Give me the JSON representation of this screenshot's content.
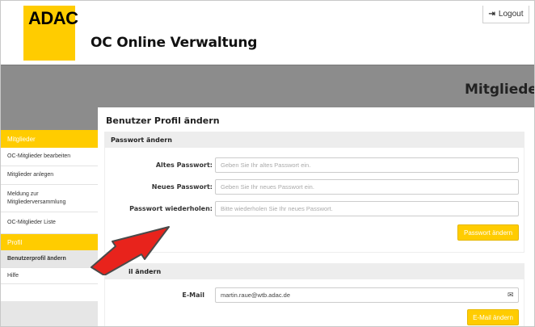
{
  "header": {
    "logo_text": "ADAC",
    "app_title": "OC Online Verwaltung",
    "logout_label": "Logout"
  },
  "banner": {
    "section_title": "Mitglieder"
  },
  "sidebar": {
    "groups": [
      {
        "heading": "Mitglieder",
        "items": [
          {
            "label": "OC-Mitglieder bearbeiten"
          },
          {
            "label": "Mitglieder anlegen"
          },
          {
            "label": "Meldung zur Mitgliederversammlung"
          },
          {
            "label": "OC-Mitglieder Liste"
          }
        ]
      },
      {
        "heading": "Profil",
        "items": [
          {
            "label": "Benutzerprofil ändern",
            "active": true
          },
          {
            "label": "Hilfe"
          }
        ]
      }
    ]
  },
  "main": {
    "page_title": "Benutzer Profil ändern",
    "password_panel": {
      "heading": "Passwort ändern",
      "fields": [
        {
          "label": "Altes Passwort:",
          "placeholder": "Geben Sie Ihr altes Passwort ein."
        },
        {
          "label": "Neues Passwort:",
          "placeholder": "Geben Sie Ihr neues Passwort ein."
        },
        {
          "label": "Passwort wiederholen:",
          "placeholder": "Bitte wiederholen Sie Ihr neues Passwort."
        }
      ],
      "button_label": "Passwort ändern"
    },
    "email_panel": {
      "heading": "il ändern",
      "label": "E-Mail",
      "value": "martin.raue@wtb.adac.de",
      "icon": "envelope-icon",
      "button_label": "E-Mail ändern"
    }
  },
  "colors": {
    "brand_yellow": "#ffcc00",
    "banner_gray": "#8c8c8c",
    "annotation_arrow": "#e8231c"
  }
}
